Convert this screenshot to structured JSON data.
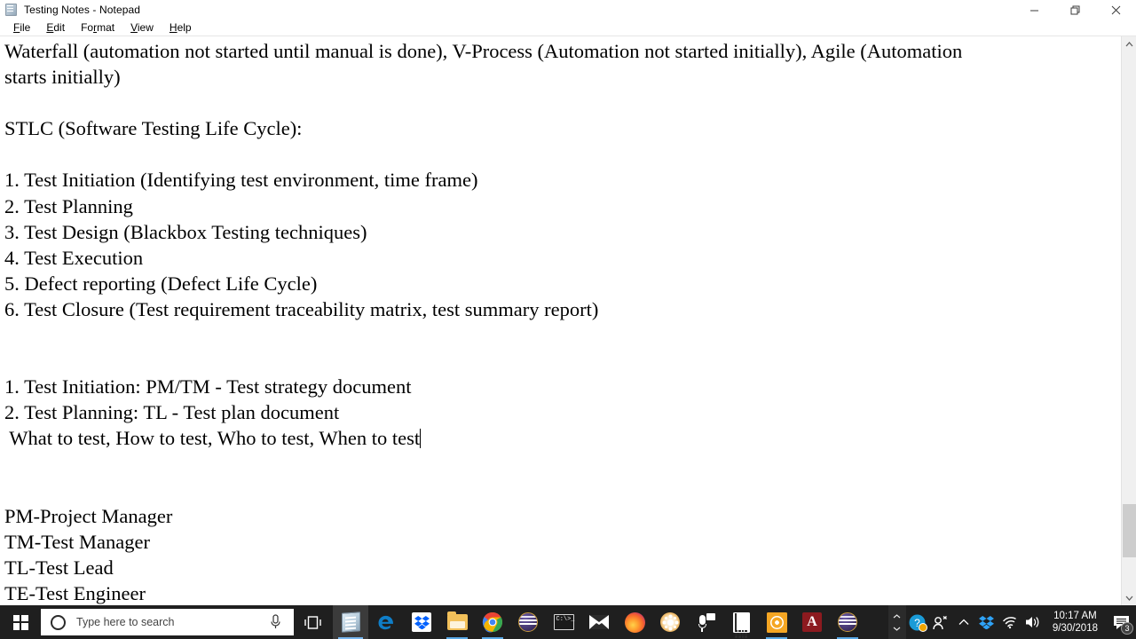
{
  "window": {
    "title": "Testing Notes - Notepad",
    "icon": "notepad-icon",
    "menu": [
      {
        "label": "File",
        "accel": "F",
        "rest": "ile"
      },
      {
        "label": "Edit",
        "accel": "E",
        "rest": "dit"
      },
      {
        "label": "Format",
        "pre": "Fo",
        "accel": "r",
        "rest": "mat"
      },
      {
        "label": "View",
        "accel": "V",
        "rest": "iew"
      },
      {
        "label": "Help",
        "accel": "H",
        "rest": "elp"
      }
    ],
    "controls": {
      "minimize": "Minimize",
      "restore": "Restore",
      "close": "Close"
    }
  },
  "document": {
    "lines": [
      "Waterfall (automation not started until manual is done), V-Process (Automation not started initially), Agile (Automation",
      "starts initially)",
      "",
      "STLC (Software Testing Life Cycle):",
      "",
      "1. Test Initiation (Identifying test environment, time frame)",
      "2. Test Planning",
      "3. Test Design (Blackbox Testing techniques)",
      "4. Test Execution",
      "5. Defect reporting (Defect Life Cycle)",
      "6. Test Closure (Test requirement traceability matrix, test summary report)",
      "",
      "",
      "1. Test Initiation: PM/TM - Test strategy document",
      "2. Test Planning: TL - Test plan document",
      " What to test, How to test, Who to test, When to test",
      "",
      "",
      "PM-Project Manager",
      "TM-Test Manager",
      "TL-Test Lead",
      "TE-Test Engineer"
    ],
    "caret_line_index": 15
  },
  "taskbar": {
    "start": "start-button",
    "search": {
      "placeholder": "Type here to search",
      "circle_icon": "cortana-circle-icon",
      "mic_icon": "microphone-icon"
    },
    "task_view": "task-view-button",
    "apps": [
      {
        "name": "notepad",
        "label": "Notepad",
        "state": "active"
      },
      {
        "name": "microsoft-edge",
        "label": "Microsoft Edge",
        "state": "idle"
      },
      {
        "name": "dropbox",
        "label": "Dropbox",
        "state": "idle"
      },
      {
        "name": "file-explorer",
        "label": "File Explorer",
        "state": "running"
      },
      {
        "name": "google-chrome",
        "label": "Google Chrome",
        "state": "running"
      },
      {
        "name": "purple-app",
        "label": "Purple App",
        "state": "idle"
      },
      {
        "name": "command-prompt",
        "label": "Command Prompt",
        "state": "idle"
      },
      {
        "name": "mail",
        "label": "Mail",
        "state": "idle"
      },
      {
        "name": "firefox",
        "label": "Mozilla Firefox",
        "state": "idle"
      },
      {
        "name": "flower-app",
        "label": "Flower App",
        "state": "idle"
      },
      {
        "name": "sound-recorder",
        "label": "Sound Recorder",
        "state": "idle"
      },
      {
        "name": "calculator",
        "label": "Calculator",
        "state": "idle"
      },
      {
        "name": "orange-app",
        "label": "Orange App",
        "state": "running"
      },
      {
        "name": "adobe-acrobat",
        "label": "Adobe Acrobat",
        "state": "idle"
      },
      {
        "name": "purple-app-2",
        "label": "Purple App",
        "state": "running"
      }
    ],
    "tray": {
      "show_hidden": "show-hidden-icons",
      "help": "help-icon",
      "people": "people-icon",
      "chevron_up": "chevron-up-icon",
      "dropbox": "dropbox-tray-icon",
      "network": "wifi-icon",
      "volume": "volume-icon",
      "time": "10:17 AM",
      "date": "9/30/2018",
      "notifications_count": "3"
    }
  },
  "colors": {
    "taskbar_bg": "#1f1f1f",
    "accent": "#5aa9e6",
    "window_bg": "#ffffff",
    "scrollbar_thumb": "#cdcdcd"
  }
}
